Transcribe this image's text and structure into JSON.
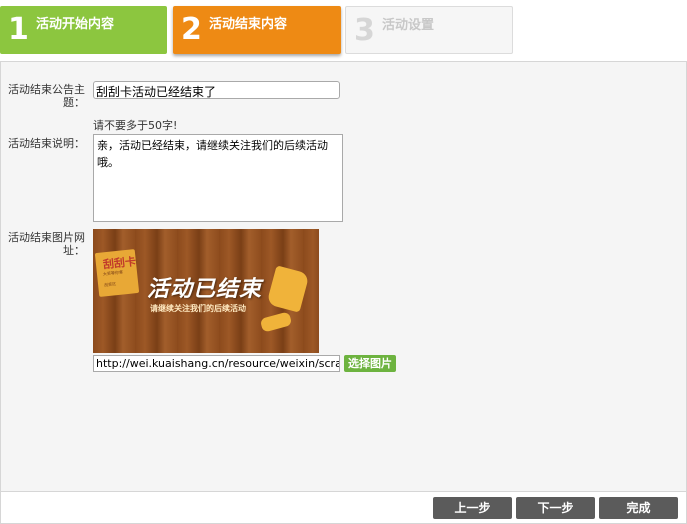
{
  "steps": [
    {
      "num": "1",
      "label": "活动开始内容",
      "color": "#8cc63f"
    },
    {
      "num": "2",
      "label": "活动结束内容",
      "color": "#ee8a14"
    },
    {
      "num": "3",
      "label": "活动设置",
      "color": "#f6f6f6"
    }
  ],
  "form": {
    "title_label": "活动结束公告主题：",
    "title_value": "刮刮卡活动已经结束了",
    "title_hint": "请不要多于50字!",
    "desc_label": "活动结束说明：",
    "desc_value": "亲，活动已经结束，请继续关注我们的后续活动哦。",
    "image_label": "活动结束图片网址：",
    "image_url_value": "http://wei.kuaishang.cn/resource/weixin/scrat",
    "choose_image_label": "选择图片"
  },
  "preview": {
    "ticket_title": "刮刮卡",
    "ticket_sub": "大奖等你拿",
    "ticket_sub2": "刮奖区",
    "headline": "活动已结束",
    "subline": "请继续关注我们的后续活动"
  },
  "footer": {
    "prev_label": "上一步",
    "next_label": "下一步",
    "done_label": "完成"
  }
}
